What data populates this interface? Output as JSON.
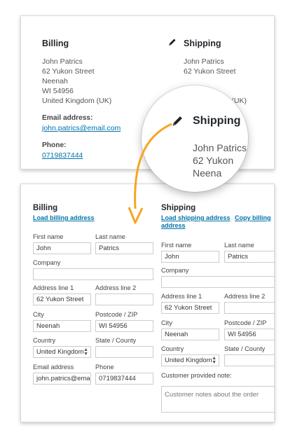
{
  "summary": {
    "billing": {
      "title": "Billing",
      "address_lines": [
        "John Patrics",
        "62 Yukon Street",
        "Neenah",
        "WI 54956",
        "United Kingdom (UK)"
      ],
      "email_label": "Email address:",
      "email": "john.patrics@email.com",
      "phone_label": "Phone:",
      "phone": "0719837444"
    },
    "shipping": {
      "title": "Shipping",
      "address_lines": [
        "John Patrics",
        "62 Yukon Street",
        "(UK)"
      ]
    },
    "magnifier": {
      "title": "Shipping",
      "address_lines": [
        "John Patrics",
        "62 Yukon",
        "Neena"
      ]
    }
  },
  "form": {
    "billing": {
      "title": "Billing",
      "load_link": "Load billing address",
      "fields": {
        "first_name": {
          "label": "First name",
          "value": "John"
        },
        "last_name": {
          "label": "Last name",
          "value": "Patrics"
        },
        "company": {
          "label": "Company",
          "value": ""
        },
        "address1": {
          "label": "Address line 1",
          "value": "62 Yukon Street"
        },
        "address2": {
          "label": "Address line 2",
          "value": ""
        },
        "city": {
          "label": "City",
          "value": "Neenah"
        },
        "postcode": {
          "label": "Postcode / ZIP",
          "value": "WI 54956"
        },
        "country": {
          "label": "Country",
          "value": "United Kingdom"
        },
        "state": {
          "label": "State / County",
          "value": ""
        },
        "email": {
          "label": "Email address",
          "value": "john.patrics@emai"
        },
        "phone": {
          "label": "Phone",
          "value": "0719837444"
        }
      }
    },
    "shipping": {
      "title": "Shipping",
      "load_link": "Load shipping address",
      "copy_link": "Copy billing address",
      "fields": {
        "first_name": {
          "label": "First name",
          "value": "John"
        },
        "last_name": {
          "label": "Last name",
          "value": "Patrics"
        },
        "company": {
          "label": "Company",
          "value": ""
        },
        "address1": {
          "label": "Address line 1",
          "value": "62 Yukon Street"
        },
        "address2": {
          "label": "Address line 2",
          "value": ""
        },
        "city": {
          "label": "City",
          "value": "Neenah"
        },
        "postcode": {
          "label": "Postcode / ZIP",
          "value": "WI 54956"
        },
        "country": {
          "label": "Country",
          "value": "United Kingdom"
        },
        "state": {
          "label": "State / County",
          "value": ""
        },
        "note": {
          "label": "Customer provided note:",
          "placeholder": "Customer notes about the order"
        }
      }
    }
  },
  "colors": {
    "link": "#0073aa",
    "arrow": "#f5a623"
  },
  "icons": {
    "edit": "pencil-icon",
    "select_caret": "select-caret-icon",
    "arrow": "curved-arrow-icon"
  }
}
